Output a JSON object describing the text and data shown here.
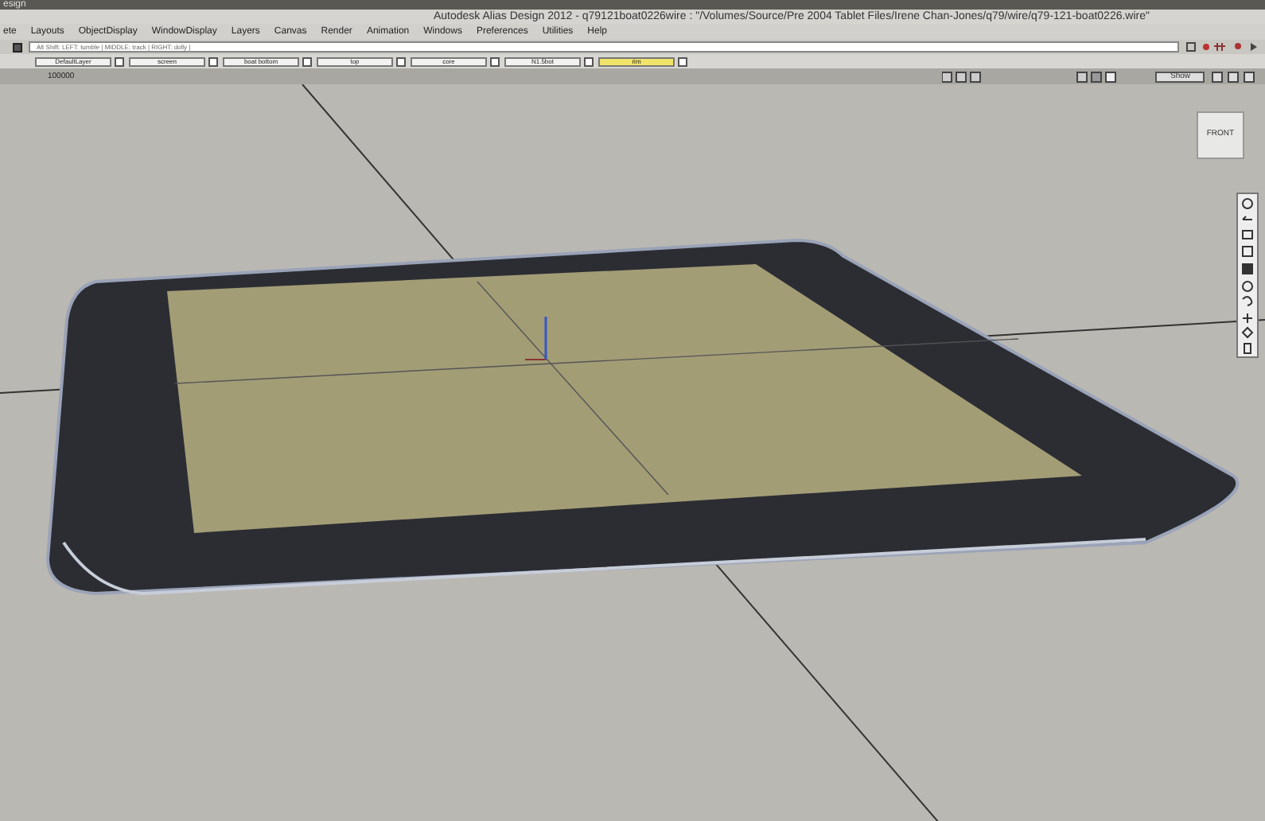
{
  "app_strip": {
    "title": "esign"
  },
  "window": {
    "title": "Autodesk Alias Design 2012 - q79121boat0226wire : \"/Volumes/Source/Pre 2004 Tablet Files/Irene Chan-Jones/q79/wire/q79-121-boat0226.wire\""
  },
  "menu": [
    "ete",
    "Layouts",
    "ObjectDisplay",
    "WindowDisplay",
    "Layers",
    "Canvas",
    "Render",
    "Animation",
    "Windows",
    "Preferences",
    "Utilities",
    "Help"
  ],
  "prompt": {
    "value": "Alt Shift:   LEFT: tumble |   MIDDLE: track |   RIGHT: dolly |"
  },
  "layers": [
    {
      "label": "DefaultLayer",
      "selected": false,
      "checked": false
    },
    {
      "label": "screen",
      "selected": false,
      "checked": false
    },
    {
      "label": "boat bottom",
      "selected": false,
      "checked": false
    },
    {
      "label": "top",
      "selected": false,
      "checked": false
    },
    {
      "label": "core",
      "selected": false,
      "checked": false
    },
    {
      "label": "N1.5bot",
      "selected": false,
      "checked": false
    },
    {
      "label": "rim",
      "selected": true,
      "checked": false
    }
  ],
  "status_bar": {
    "value": "100000",
    "show_button": "Show"
  },
  "viewcube": {
    "label": "FRONT"
  }
}
